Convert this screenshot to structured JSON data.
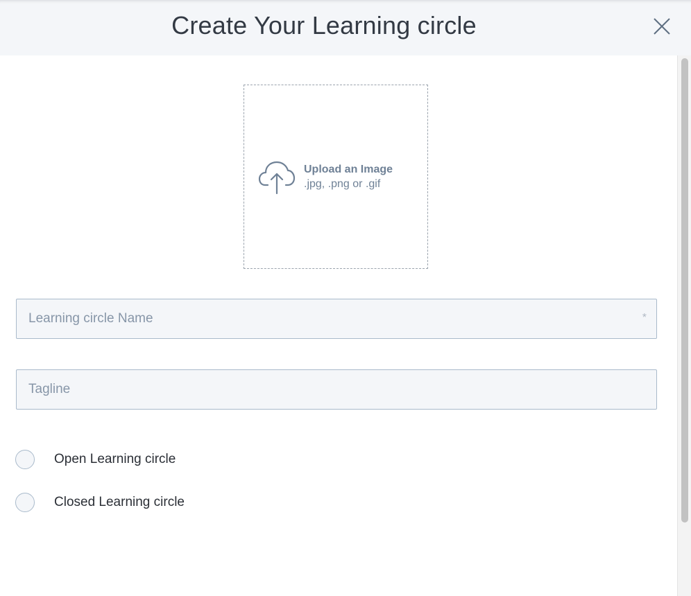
{
  "dialog": {
    "title": "Create Your Learning circle",
    "close_icon": "close-icon"
  },
  "upload": {
    "icon": "cloud-upload-icon",
    "title": "Upload an Image",
    "formats": ".jpg, .png or .gif"
  },
  "form": {
    "name_field": {
      "placeholder": "Learning circle Name",
      "value": "",
      "required_marker": "*"
    },
    "tagline_field": {
      "placeholder": "Tagline",
      "value": ""
    },
    "privacy_options": [
      {
        "label": "Open Learning circle",
        "selected": false
      },
      {
        "label": "Closed Learning circle",
        "selected": false
      }
    ]
  },
  "colors": {
    "header_bg": "#f4f6f9",
    "field_bg": "#f4f6f9",
    "field_border": "#a9bacb",
    "muted_text": "#6f8196"
  }
}
